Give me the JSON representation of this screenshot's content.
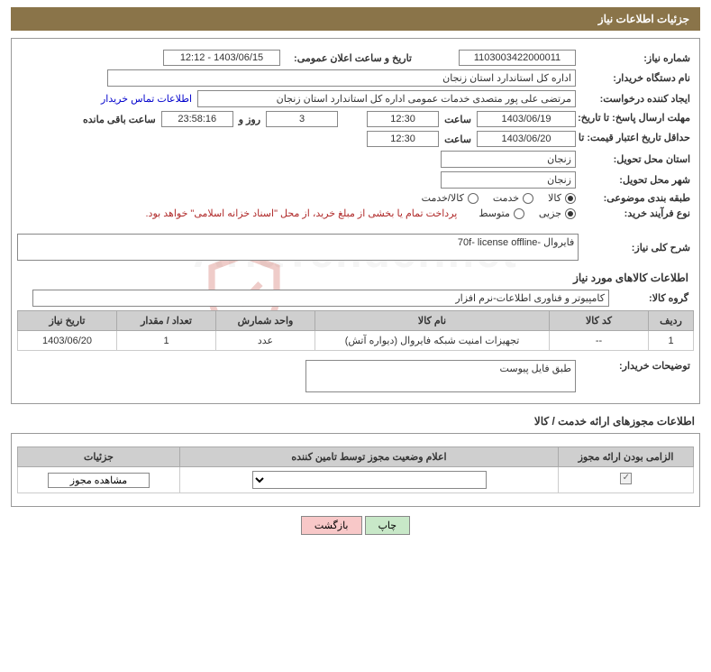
{
  "header": {
    "title": "جزئیات اطلاعات نیاز"
  },
  "need": {
    "number_label": "شماره نیاز:",
    "number": "1103003422000011",
    "announce_label": "تاریخ و ساعت اعلان عمومی:",
    "announce": "1403/06/15 - 12:12",
    "buyer_label": "نام دستگاه خریدار:",
    "buyer": "اداره کل استاندارد استان زنجان",
    "requester_label": "ایجاد کننده درخواست:",
    "requester": "مرتضی علی پور متصدی خدمات عمومی اداره کل استاندارد استان زنجان",
    "contact_link": "اطلاعات تماس خریدار",
    "deadline_label": "مهلت ارسال پاسخ: تا تاریخ:",
    "deadline_date": "1403/06/19",
    "time_label": "ساعت",
    "deadline_time": "12:30",
    "days": "3",
    "days_label": "روز و",
    "countdown": "23:58:16",
    "remain_label": "ساعت باقی مانده",
    "validity_label": "حداقل تاریخ اعتبار قیمت: تا تاریخ:",
    "validity_date": "1403/06/20",
    "validity_time": "12:30",
    "province_label": "استان محل تحویل:",
    "province": "زنجان",
    "city_label": "شهر محل تحویل:",
    "city": "زنجان",
    "category_label": "طبقه بندی موضوعی:",
    "cat_goods": "کالا",
    "cat_service": "خدمت",
    "cat_both": "کالا/خدمت",
    "process_label": "نوع فرآیند خرید:",
    "proc_partial": "جزیی",
    "proc_medium": "متوسط",
    "process_note": "پرداخت تمام یا بخشی از مبلغ خرید، از محل \"اسناد خزانه اسلامی\" خواهد بود.",
    "desc_label": "شرح کلی نیاز:",
    "desc": "فایروال -70f- license offline"
  },
  "goods": {
    "section_title": "اطلاعات کالاهای مورد نیاز",
    "group_label": "گروه کالا:",
    "group": "کامپیوتر و فناوری اطلاعات-نرم افزار",
    "headers": {
      "row": "ردیف",
      "code": "کد کالا",
      "name": "نام کالا",
      "unit": "واحد شمارش",
      "qty": "تعداد / مقدار",
      "date": "تاریخ نیاز"
    },
    "rows": [
      {
        "idx": "1",
        "code": "--",
        "name": "تجهیزات امنیت شبکه فایروال (دیواره آتش)",
        "unit": "عدد",
        "qty": "1",
        "date": "1403/06/20"
      }
    ],
    "note_label": "توضیحات خریدار:",
    "note": "طبق فایل پیوست"
  },
  "license": {
    "section_title": "اطلاعات مجوزهای ارائه خدمت / کالا",
    "headers": {
      "mandatory": "الزامی بودن ارائه مجوز",
      "status": "اعلام وضعیت مجوز توسط تامین کننده",
      "detail": "جزئیات"
    },
    "detail_btn": "مشاهده مجوز"
  },
  "buttons": {
    "print": "چاپ",
    "back": "بازگشت"
  }
}
